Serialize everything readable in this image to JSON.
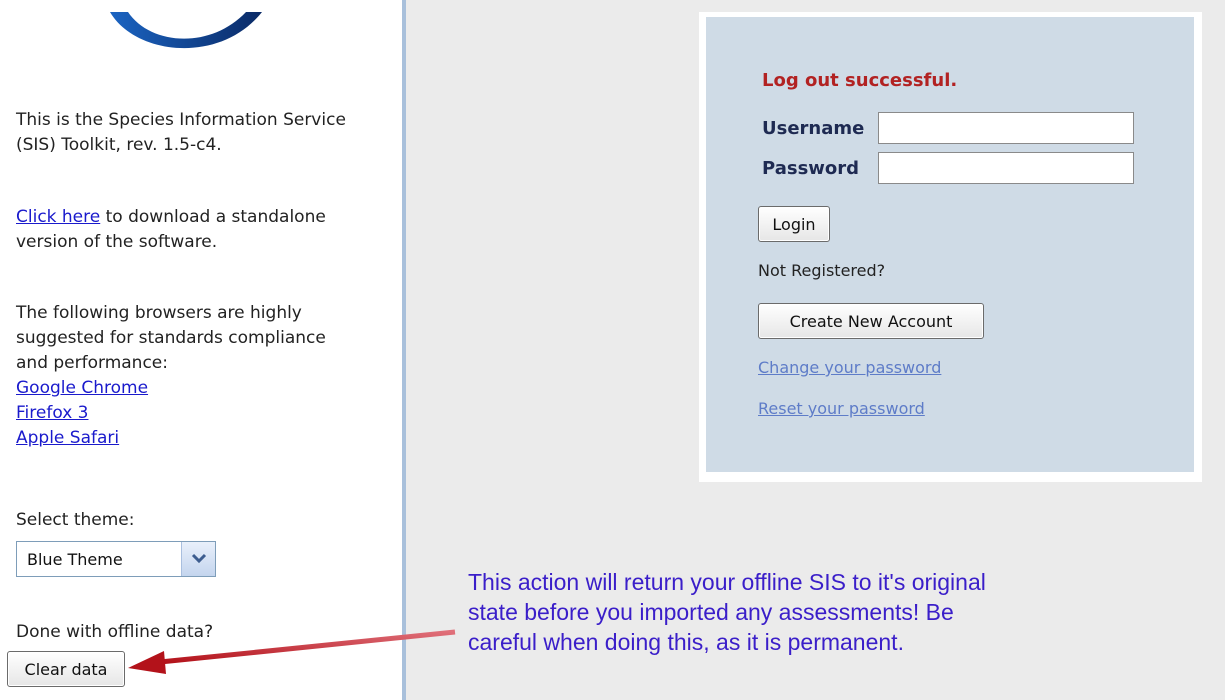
{
  "sidebar": {
    "intro_text_1": "This is the Species Information Service",
    "intro_text_2": "(SIS) Toolkit, rev. 1.5-c4.",
    "download_link": "Click here",
    "download_text_1": " to download a standalone",
    "download_text_2": "version of the software.",
    "browsers_intro_1": "The following browsers are highly",
    "browsers_intro_2": "suggested for standards compliance",
    "browsers_intro_3": "and performance:",
    "browser_links": [
      "Google Chrome",
      "Firefox 3",
      "Apple Safari"
    ],
    "theme_label": "Select theme:",
    "theme_value": "Blue Theme",
    "offline_label": "Done with offline data?",
    "clear_button": "Clear data"
  },
  "login": {
    "status_message": "Log out successful.",
    "username_label": "Username",
    "username_value": "",
    "password_label": "Password",
    "password_value": "",
    "login_button": "Login",
    "not_registered": "Not Registered?",
    "create_account_button": "Create New Account",
    "change_password_link": "Change your password",
    "reset_password_link": "Reset your password"
  },
  "annotation": {
    "warning_line_1": "This action will return your offline SIS to it's original",
    "warning_line_2": "state before you imported any assessments!  Be",
    "warning_line_3": "careful when doing this, as it is permanent.",
    "arrow_color": "#c0181e",
    "text_color": "#3a1ec9"
  },
  "icons": {
    "logo": "sis-logo-arc",
    "dropdown": "chevron-down-icon"
  }
}
